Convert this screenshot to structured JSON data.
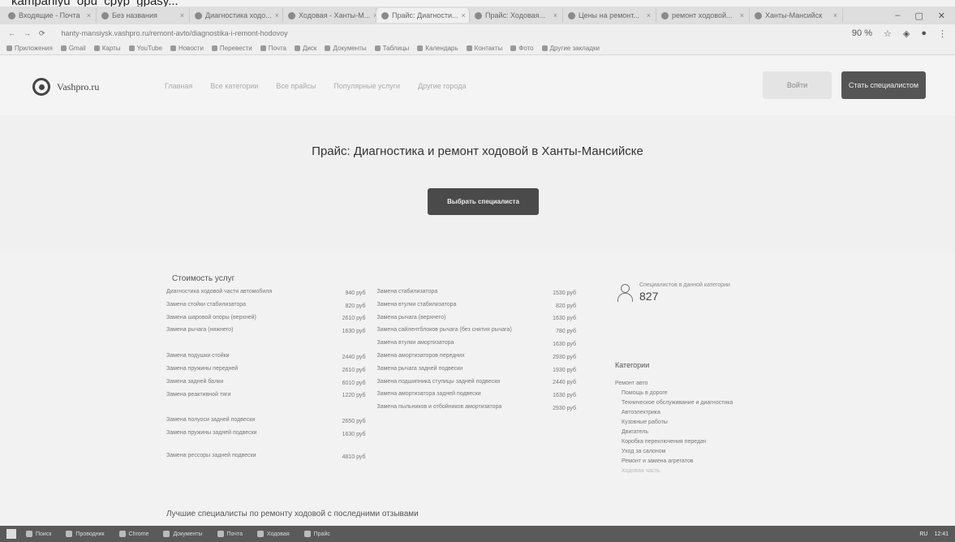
{
  "cutoff_text": "kampaniyu_opu_cpyp_gpasy...",
  "browser": {
    "tabs": [
      {
        "label": "Входящие - Почта"
      },
      {
        "label": "Без названия"
      },
      {
        "label": "Диагностика ходо..."
      },
      {
        "label": "Ходовая - Ханты-М..."
      },
      {
        "label": "Прайс: Диагности..."
      },
      {
        "label": "Прайс: Ходовая..."
      },
      {
        "label": "Цены на ремонт..."
      },
      {
        "label": "ремонт ходовой..."
      },
      {
        "label": "Ханты-Мансийск"
      }
    ],
    "url": "hanty-mansiysk.vashpro.ru/remont-avto/diagnostika-i-remont-hodovoy",
    "zoom": "90 %",
    "bookmarks": [
      "Приложения",
      "Gmail",
      "Карты",
      "YouTube",
      "Новости",
      "Перевести",
      "Почта",
      "Диск",
      "Документы",
      "Таблицы",
      "Календарь",
      "Контакты",
      "Фото",
      "Другие закладки"
    ]
  },
  "site": {
    "logo_text": "Vashpro.ru",
    "nav": [
      "Главная",
      "Все категории",
      "Все прайсы",
      "Популярные услуги",
      "Другие города"
    ],
    "login_label": "Войти",
    "become_label": "Стать специалистом",
    "hero_title": "Прайс: Диагностика и ремонт ходовой в Ханты-Мансийске",
    "choose_button": "Выбрать специалиста"
  },
  "prices": {
    "title": "Стоимость услуг",
    "left": [
      {
        "service": "Диагностика ходовой части автомобиля",
        "price": "940 руб"
      },
      {
        "service": "Замена стойки стабилизатора",
        "price": "820 руб"
      },
      {
        "service": "Замена шаровой опоры (верхней)",
        "price": "2610 руб"
      },
      {
        "service": "Замена рычага (нижнего)",
        "price": "1630 руб"
      },
      {
        "service": "Замена подушки стойки",
        "price": "2440 руб"
      },
      {
        "service": "Замена пружины передней",
        "price": "2610 руб"
      },
      {
        "service": "Замена задней балки",
        "price": "6010 руб"
      },
      {
        "service": "Замена реактивной тяги",
        "price": "1220 руб"
      },
      {
        "service": "Замена полуоси задней подвески",
        "price": "2650 руб"
      },
      {
        "service": "Замена пружины задней подвески",
        "price": "1630 руб"
      },
      {
        "service": "Замена рессоры задней подвески",
        "price": "4810 руб"
      }
    ],
    "right": [
      {
        "service": "Замена стабилизатора",
        "price": "1530 руб"
      },
      {
        "service": "Замена втулки стабилизатора",
        "price": "820 руб"
      },
      {
        "service": "Замена рычага (верхнего)",
        "price": "1630 руб"
      },
      {
        "service": "Замена сайлентблоков рычага (без снятия рычага)",
        "price": "780 руб"
      },
      {
        "service": "Замена втулки амортизатора",
        "price": "1630 руб"
      },
      {
        "service": "Замена амортизаторов передних",
        "price": "2930 руб"
      },
      {
        "service": "Замена рычага задней подвески",
        "price": "1930 руб"
      },
      {
        "service": "Замена подшипника ступицы задней подвески",
        "price": "2440 руб"
      },
      {
        "service": "Замена амортизатора задней подвески",
        "price": "1630 руб"
      },
      {
        "service": "Замена пыльников и отбойников амортизатора",
        "price": "2930 руб"
      }
    ]
  },
  "sidebar": {
    "spec_label": "Специалистов в данной категории",
    "spec_count": "827",
    "categories_title": "Категории",
    "category_top": "Ремонт авто",
    "categories": [
      "Помощь в дороге",
      "Техническое обслуживание и диагностика",
      "Автоэлектрика",
      "Кузовные работы",
      "Двигатель",
      "Коробка переключения передач",
      "Уход за салоном",
      "Ремонт и замена агрегатов"
    ],
    "category_faded": "Ходовая часть"
  },
  "best_title": "Лучшие специалисты по ремонту ходовой с последними отзывами",
  "taskbar": {
    "items": [
      "Поиск",
      "Проводник",
      "Chrome",
      "Документы",
      "Почта",
      "Ходовая",
      "Прайс"
    ],
    "tray": [
      "RU",
      "12:41"
    ]
  }
}
